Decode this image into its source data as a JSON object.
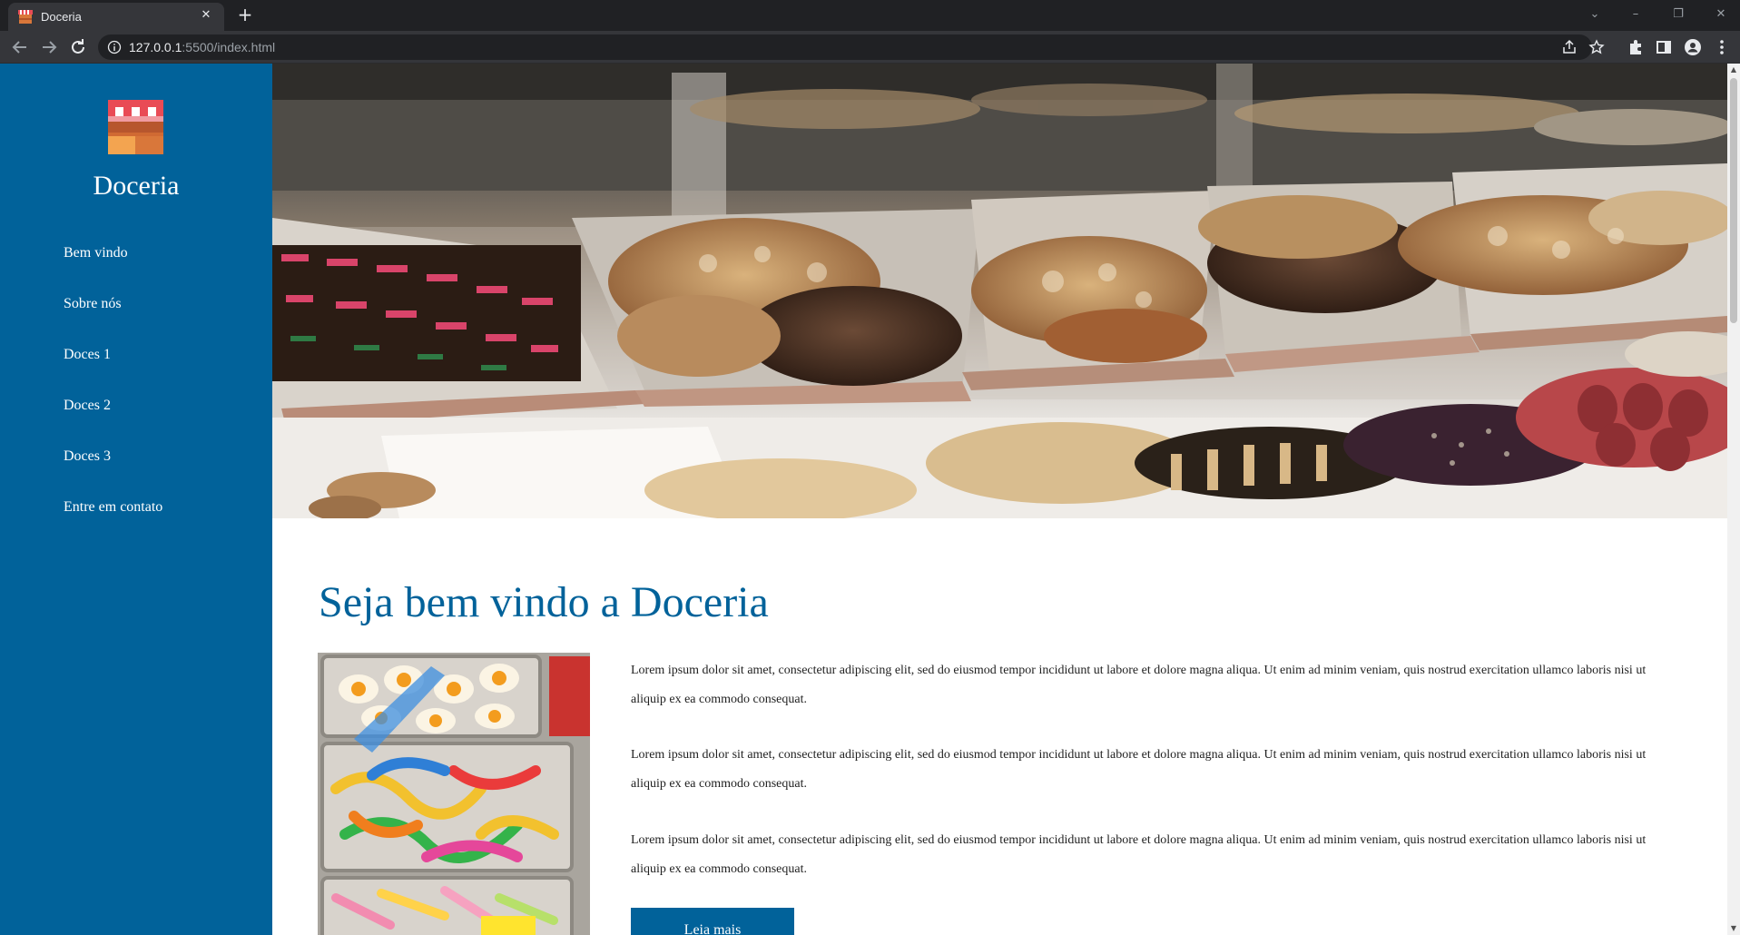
{
  "browser": {
    "tab_title": "Doceria",
    "url_host": "127.0.0.1",
    "url_path": ":5500/index.html"
  },
  "sidebar": {
    "brand": "Doceria",
    "menu": [
      {
        "label": "Bem vindo"
      },
      {
        "label": "Sobre nós"
      },
      {
        "label": "Doces 1"
      },
      {
        "label": "Doces 2"
      },
      {
        "label": "Doces 3"
      },
      {
        "label": "Entre em contato"
      }
    ]
  },
  "main": {
    "heading": "Seja bem vindo a Doceria",
    "paragraphs": [
      "Lorem ipsum dolor sit amet, consectetur adipiscing elit, sed do eiusmod tempor incididunt ut labore et dolore magna aliqua. Ut enim ad minim veniam, quis nostrud exercitation ullamco laboris nisi ut aliquip ex ea commodo consequat.",
      "Lorem ipsum dolor sit amet, consectetur adipiscing elit, sed do eiusmod tempor incididunt ut labore et dolore magna aliqua. Ut enim ad minim veniam, quis nostrud exercitation ullamco laboris nisi ut aliquip ex ea commodo consequat.",
      "Lorem ipsum dolor sit amet, consectetur adipiscing elit, sed do eiusmod tempor incididunt ut labore et dolore magna aliqua. Ut enim ad minim veniam, quis nostrud exercitation ullamco laboris nisi ut aliquip ex ea commodo consequat."
    ],
    "button_label": "Leia mais"
  },
  "colors": {
    "primary": "#01629a",
    "chrome_dark": "#202124",
    "chrome_mid": "#35363a"
  },
  "icons": [
    "store-favicon",
    "close-icon",
    "plus-icon",
    "back-arrow-icon",
    "forward-arrow-icon",
    "reload-icon",
    "info-icon",
    "share-icon",
    "star-icon",
    "puzzle-icon",
    "side-panel-icon",
    "profile-icon",
    "kebab-menu-icon"
  ]
}
